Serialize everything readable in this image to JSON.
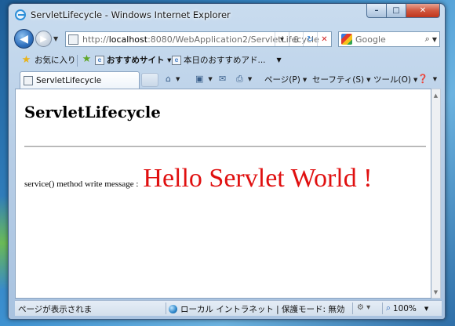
{
  "window": {
    "title": "ServletLifecycle - Windows Internet Explorer",
    "buttons": {
      "minimize": "–",
      "maximize": "□",
      "close": "✕"
    }
  },
  "address": {
    "url_prefix": "http://",
    "url_host": "localhost",
    "url_rest": ":8080/WebApplication2/ServletLifecycle",
    "search_placeholder": "Google"
  },
  "favorites": {
    "favorites_label": "お気に入り",
    "items": [
      {
        "label": "おすすめサイト ▾",
        "icon": "ie-page-icon"
      },
      {
        "label": "本日のおすすめアド...",
        "icon": "ie-page-icon"
      }
    ]
  },
  "tabs": [
    {
      "label": "ServletLifecycle"
    }
  ],
  "commands": {
    "page": "ページ(P)",
    "safety": "セーフティ(S)",
    "tools": "ツール(O)"
  },
  "page": {
    "heading": "ServletLifecycle",
    "message_label": "service() method write message :",
    "message": "Hello Servlet World !"
  },
  "status": {
    "text": "ページが表示されま",
    "zone": "ローカル イントラネット | 保護モード: 無効",
    "zoom": "100%"
  }
}
